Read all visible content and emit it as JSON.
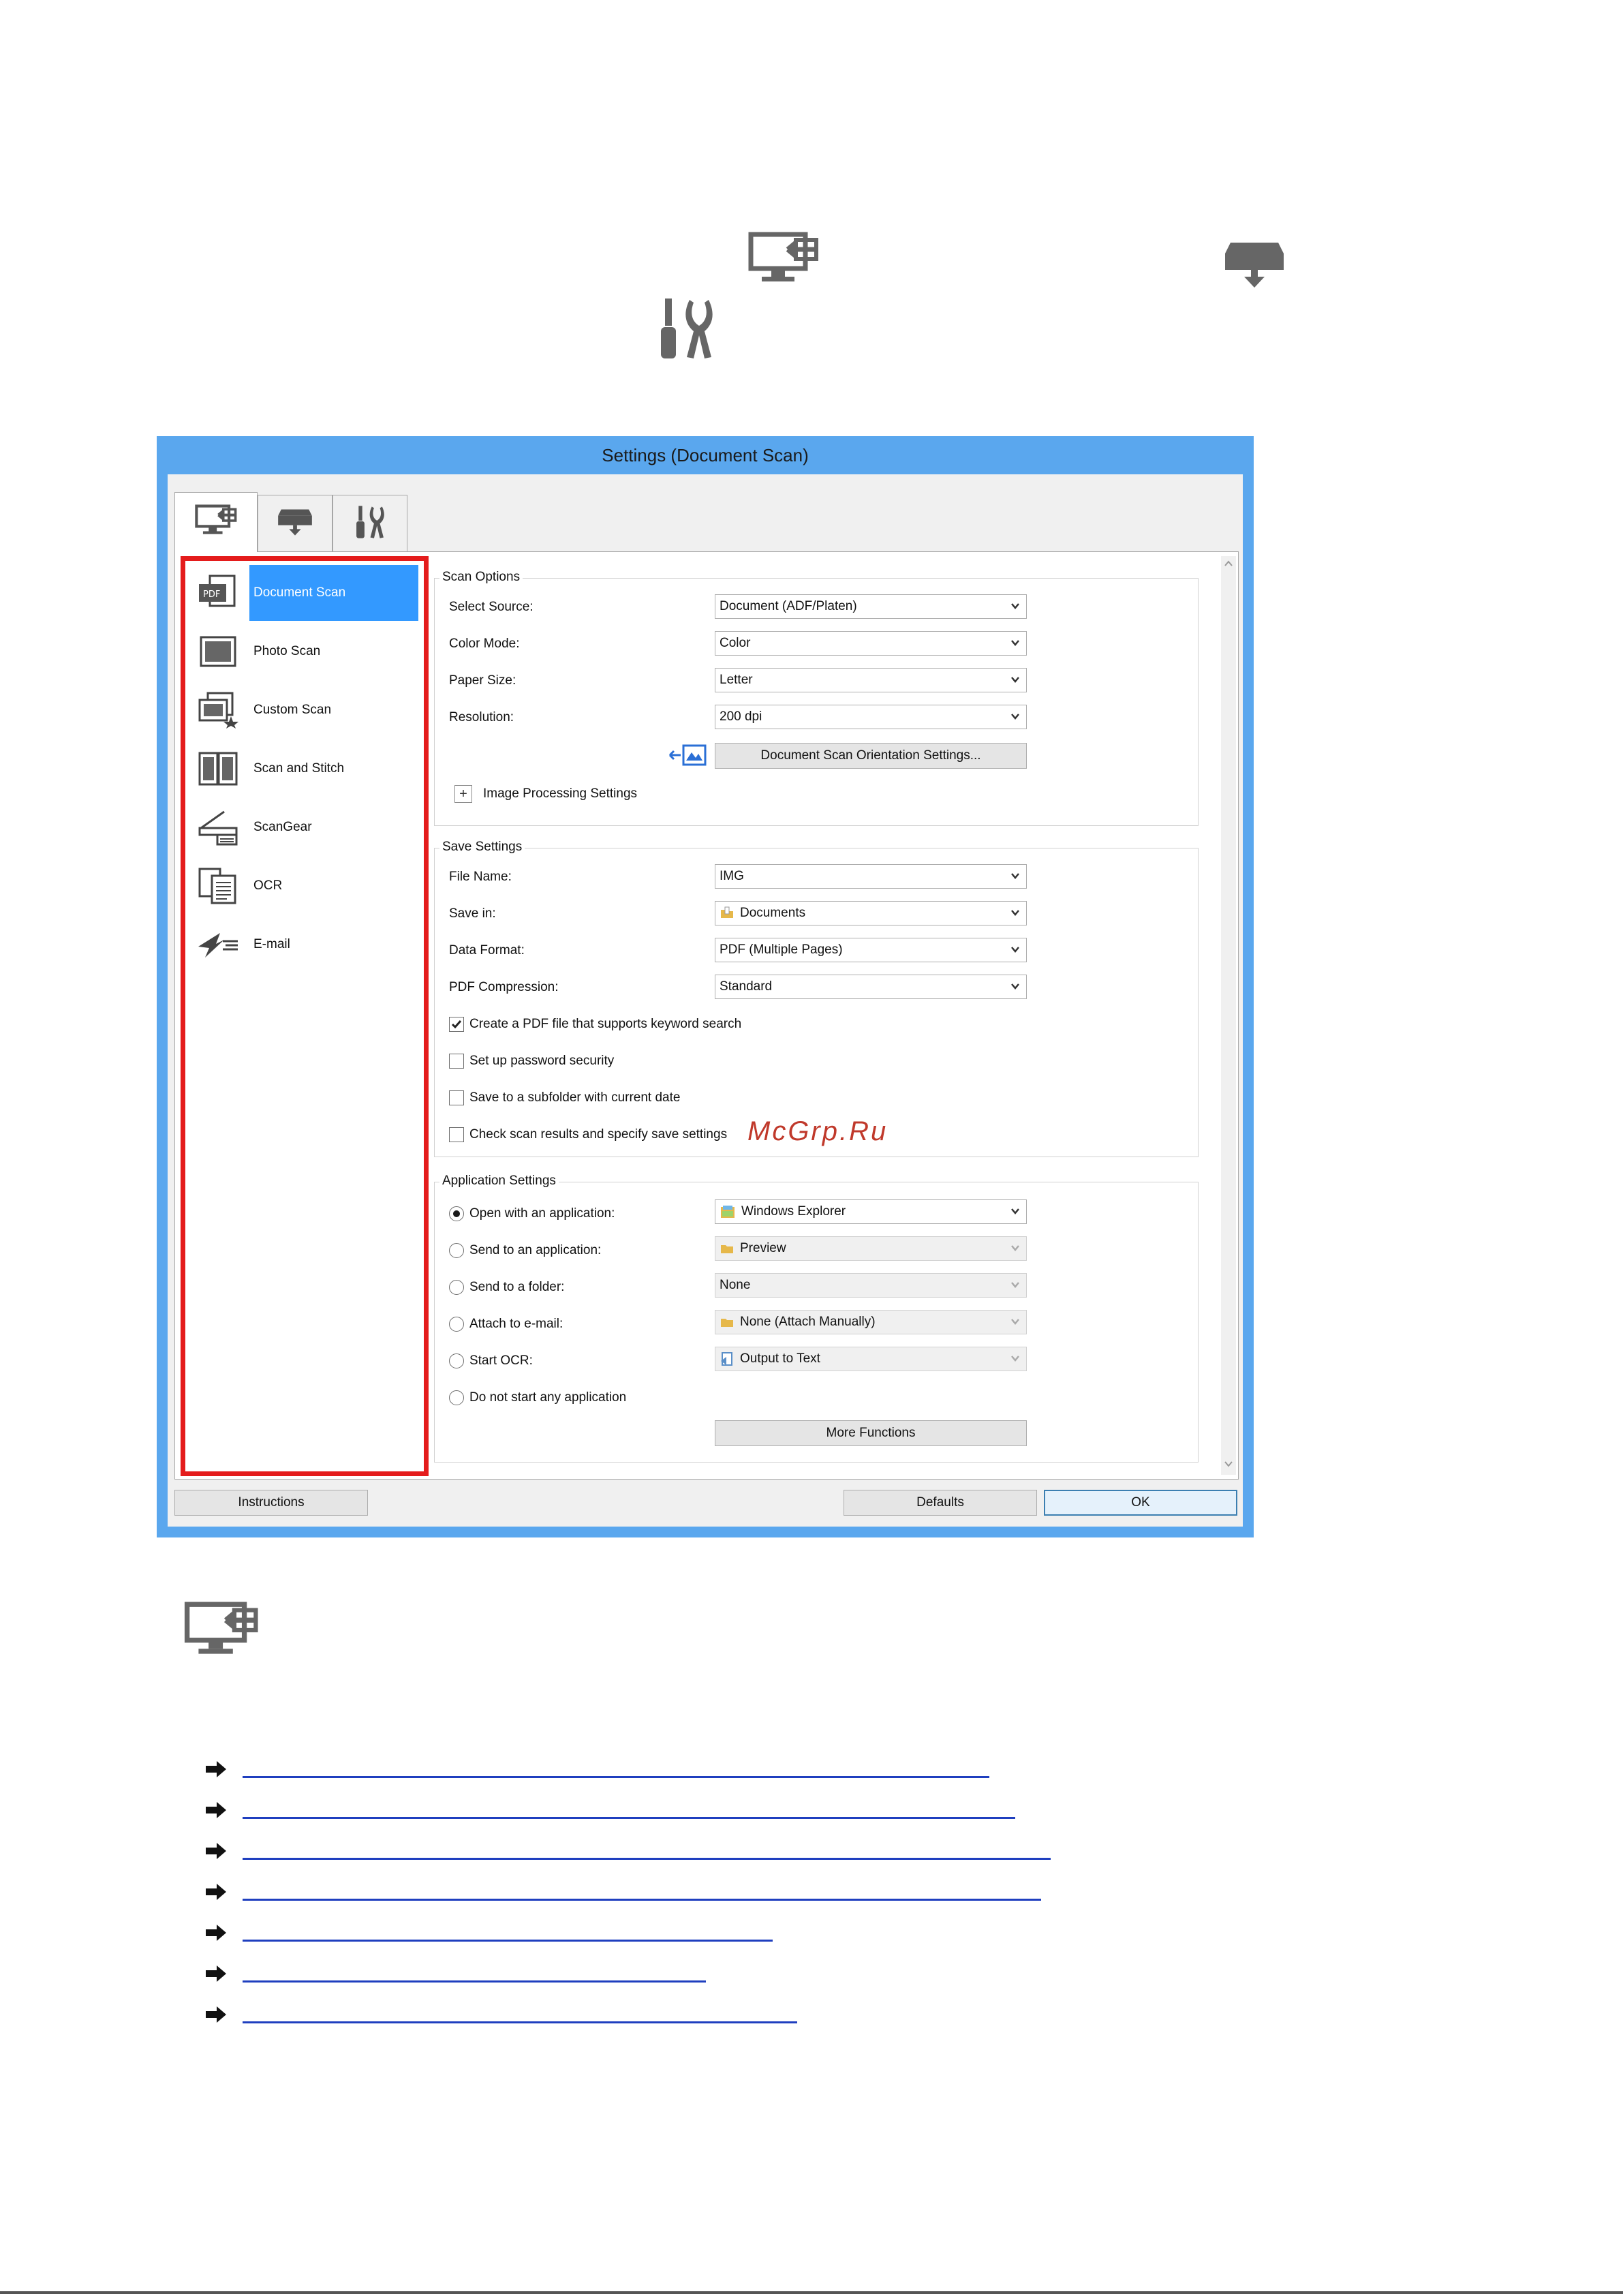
{
  "window": {
    "title": "Settings (Document Scan)"
  },
  "tabs": [
    {
      "name": "scan-from-computer",
      "icon": "monitor-arrow-icon"
    },
    {
      "name": "scan-from-operation-panel",
      "icon": "scanner-download-icon"
    },
    {
      "name": "general-settings",
      "icon": "tools-icon"
    }
  ],
  "sidebar": {
    "items": [
      {
        "label": "Document Scan",
        "icon": "pdf-document-icon",
        "selected": true
      },
      {
        "label": "Photo Scan",
        "icon": "photo-icon"
      },
      {
        "label": "Custom Scan",
        "icon": "custom-scan-icon"
      },
      {
        "label": "Scan and Stitch",
        "icon": "stitch-icon"
      },
      {
        "label": "ScanGear",
        "icon": "scangear-icon"
      },
      {
        "label": "OCR",
        "icon": "ocr-icon"
      },
      {
        "label": "E-mail",
        "icon": "email-icon"
      }
    ]
  },
  "scan_options": {
    "title": "Scan Options",
    "select_source_label": "Select Source:",
    "select_source_value": "Document (ADF/Platen)",
    "color_mode_label": "Color Mode:",
    "color_mode_value": "Color",
    "paper_size_label": "Paper Size:",
    "paper_size_value": "Letter",
    "resolution_label": "Resolution:",
    "resolution_value": "200 dpi",
    "orientation_button": "Document Scan Orientation Settings...",
    "image_processing_label": "Image Processing Settings"
  },
  "save_settings": {
    "title": "Save Settings",
    "file_name_label": "File Name:",
    "file_name_value": "IMG",
    "save_in_label": "Save in:",
    "save_in_value": "Documents",
    "data_format_label": "Data Format:",
    "data_format_value": "PDF (Multiple Pages)",
    "pdf_compression_label": "PDF Compression:",
    "pdf_compression_value": "Standard",
    "keyword_search_label": "Create a PDF file that supports keyword search",
    "keyword_search_checked": true,
    "password_label": "Set up password security",
    "subfolder_label": "Save to a subfolder with current date",
    "check_results_label": "Check scan results and specify save settings"
  },
  "application_settings": {
    "title": "Application Settings",
    "open_with_label": "Open with an application:",
    "open_with_value": "Windows Explorer",
    "send_to_app_label": "Send to an application:",
    "send_to_app_value": "Preview",
    "send_to_folder_label": "Send to a folder:",
    "send_to_folder_value": "None",
    "attach_email_label": "Attach to e-mail:",
    "attach_email_value": "None (Attach Manually)",
    "start_ocr_label": "Start OCR:",
    "start_ocr_value": "Output to Text",
    "do_not_start_label": "Do not start any application",
    "more_functions_button": "More Functions"
  },
  "footer": {
    "instructions_button": "Instructions",
    "defaults_button": "Defaults",
    "ok_button": "OK"
  },
  "watermark": "McGrp.Ru",
  "colors": {
    "title_bar": "#5aa7ee",
    "selected_item": "#3399ff",
    "highlight_border": "#e41c1c",
    "link": "#1f3fbf"
  }
}
